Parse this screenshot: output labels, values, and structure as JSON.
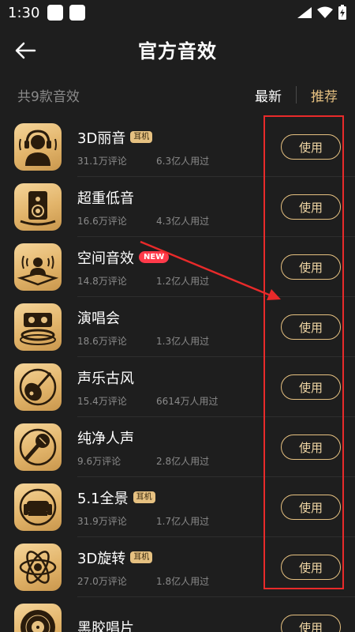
{
  "status": {
    "time": "1:30"
  },
  "header": {
    "title": "官方音效"
  },
  "filter": {
    "count_text": "共9款音效",
    "sort_newest": "最新",
    "sort_recommend": "推荐"
  },
  "effects": [
    {
      "name": "3D丽音",
      "badge": "耳机",
      "badge_type": "earphone",
      "comments": "31.1万评论",
      "users": "6.3亿人用过",
      "icon": "headphones-person-icon",
      "button": "使用"
    },
    {
      "name": "超重低音",
      "badge": "",
      "badge_type": "",
      "comments": "16.6万评论",
      "users": "4.3亿人用过",
      "icon": "speaker-icon",
      "button": "使用"
    },
    {
      "name": "空间音效",
      "badge": "NEW",
      "badge_type": "new",
      "comments": "14.8万评论",
      "users": "1.2亿人用过",
      "icon": "spatial-audio-icon",
      "button": "使用"
    },
    {
      "name": "演唱会",
      "badge": "",
      "badge_type": "",
      "comments": "18.6万评论",
      "users": "1.3亿人用过",
      "icon": "concert-stage-icon",
      "button": "使用"
    },
    {
      "name": "声乐古风",
      "badge": "",
      "badge_type": "",
      "comments": "15.4万评论",
      "users": "6614万人用过",
      "icon": "pipa-instrument-icon",
      "button": "使用"
    },
    {
      "name": "纯净人声",
      "badge": "",
      "badge_type": "",
      "comments": "9.6万评论",
      "users": "2.8亿人用过",
      "icon": "microphone-icon",
      "button": "使用"
    },
    {
      "name": "5.1全景",
      "badge": "耳机",
      "badge_type": "earphone",
      "comments": "31.9万评论",
      "users": "1.7亿人用过",
      "icon": "surround-sofa-icon",
      "button": "使用"
    },
    {
      "name": "3D旋转",
      "badge": "耳机",
      "badge_type": "earphone",
      "comments": "27.0万评论",
      "users": "1.8亿人用过",
      "icon": "orbit-atom-icon",
      "button": "使用"
    },
    {
      "name": "黑胶唱片",
      "badge": "",
      "badge_type": "",
      "comments": "",
      "users": "",
      "icon": "vinyl-record-icon",
      "button": "使用"
    }
  ],
  "colors": {
    "accent": "#e6c181",
    "background": "#1e1e1e",
    "annotation": "#e82a2a"
  }
}
